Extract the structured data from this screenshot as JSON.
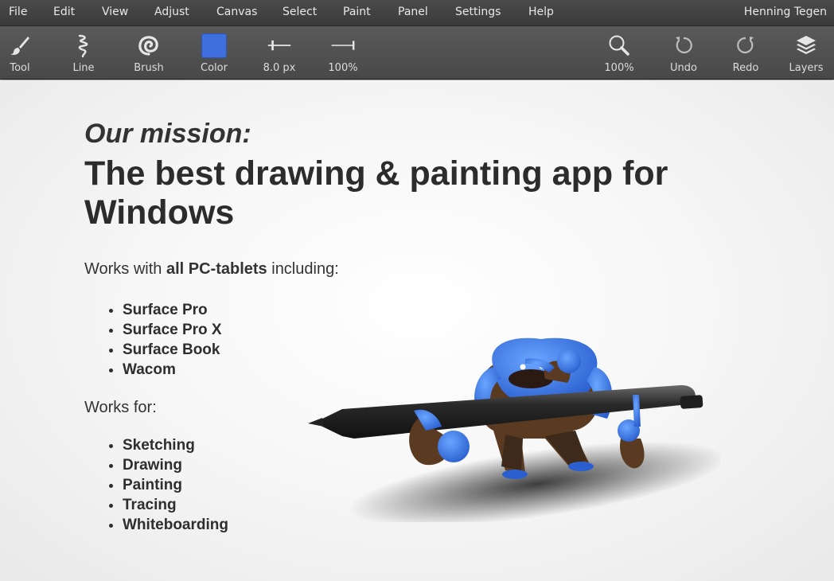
{
  "menubar": {
    "items": [
      "File",
      "Edit",
      "View",
      "Adjust",
      "Canvas",
      "Select",
      "Paint",
      "Panel",
      "Settings",
      "Help"
    ],
    "user": "Henning Tegen"
  },
  "toolbar": {
    "tool": {
      "label": "Tool",
      "icon": "brush-tool-icon"
    },
    "line": {
      "label": "Line",
      "icon": "squiggle-line-icon"
    },
    "brush": {
      "label": "Brush",
      "icon": "spiral-brush-icon"
    },
    "color": {
      "label": "Color",
      "value": "#3f6fdc"
    },
    "size": {
      "label": "8.0 px",
      "icon": "brush-size-slider-icon"
    },
    "opacity": {
      "label": "100%",
      "icon": "opacity-slider-icon"
    },
    "zoom": {
      "label": "100%",
      "icon": "magnifier-icon"
    },
    "undo": {
      "label": "Undo",
      "icon": "undo-icon"
    },
    "redo": {
      "label": "Redo",
      "icon": "redo-icon"
    },
    "layers": {
      "label": "Layers",
      "icon": "layers-icon"
    }
  },
  "content": {
    "mission": "Our mission:",
    "headline": "The best drawing & painting app for Windows",
    "works_with": {
      "prefix": "Works with ",
      "bold": "all PC-tablets",
      "suffix": " including:"
    },
    "tablets": [
      "Surface Pro",
      "Surface Pro X",
      "Surface Book",
      "Wacom"
    ],
    "works_for": "Works for:",
    "uses": [
      "Sketching",
      "Drawing",
      "Painting",
      "Tracing",
      "Whiteboarding"
    ]
  },
  "colors": {
    "accent_blue": "#3f6fdc",
    "creature_blue": "#3d7ee6"
  }
}
